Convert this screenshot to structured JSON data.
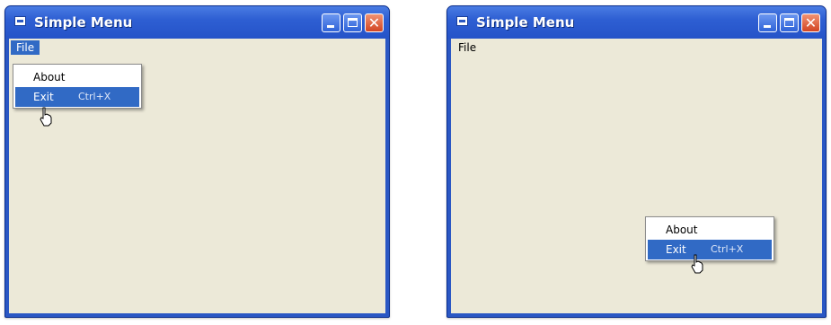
{
  "windows": [
    {
      "title": "Simple Menu",
      "menubar": [
        {
          "label": "File",
          "active": true
        }
      ],
      "context_menu": [
        {
          "label": "About",
          "highlighted": false
        },
        {
          "label": "Exit",
          "shortcut": "Ctrl+X",
          "highlighted": true
        }
      ]
    },
    {
      "title": "Simple Menu",
      "menubar": [
        {
          "label": "File",
          "active": false
        }
      ],
      "context_menu": [
        {
          "label": "About",
          "highlighted": false
        },
        {
          "label": "Exit",
          "shortcut": "Ctrl+X",
          "highlighted": true
        }
      ]
    }
  ],
  "icons": {
    "app": "app-window-icon",
    "minimize": "minimize-icon",
    "maximize": "maximize-icon",
    "close": "close-icon",
    "cursor": "hand-pointer-cursor-icon"
  },
  "colors": {
    "titlebar": "#2a57c4",
    "client_background": "#ece9d8",
    "menu_highlight": "#316ac5",
    "close_button": "#d24523"
  }
}
